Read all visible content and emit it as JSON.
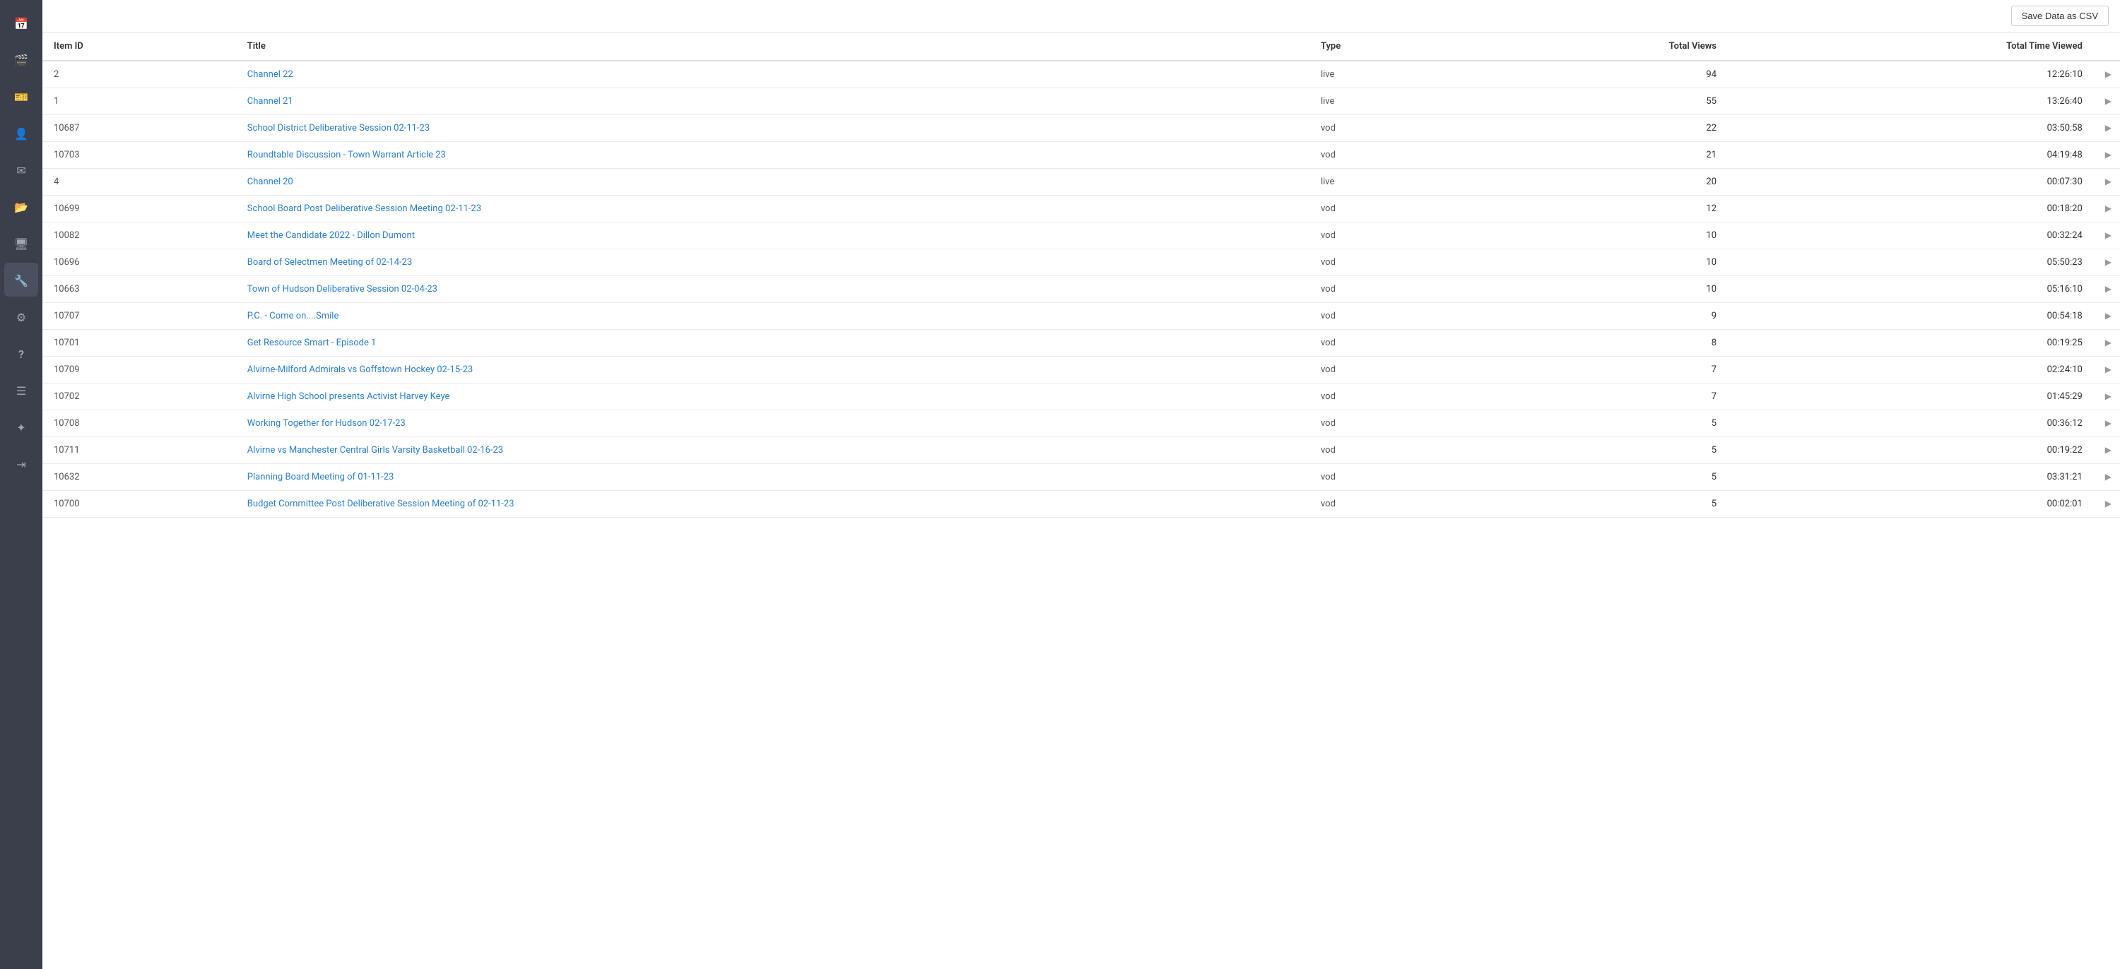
{
  "sidebar": {
    "items": [
      {
        "id": "calendar",
        "icon": "icon-calendar",
        "label": "Calendar",
        "active": false
      },
      {
        "id": "film",
        "icon": "icon-film",
        "label": "Media",
        "active": false
      },
      {
        "id": "badge",
        "icon": "icon-badge",
        "label": "Badge",
        "active": false
      },
      {
        "id": "user",
        "icon": "icon-user",
        "label": "User",
        "active": false
      },
      {
        "id": "send",
        "icon": "icon-send",
        "label": "Send",
        "active": false
      },
      {
        "id": "folder",
        "icon": "icon-folder",
        "label": "Folder",
        "active": false
      },
      {
        "id": "monitor",
        "icon": "icon-monitor",
        "label": "Monitor",
        "active": false
      },
      {
        "id": "wrench",
        "icon": "icon-wrench",
        "label": "Tools",
        "active": true
      },
      {
        "id": "gear",
        "icon": "icon-gear",
        "label": "Settings",
        "active": false
      },
      {
        "id": "question",
        "icon": "icon-question",
        "label": "Help",
        "active": false
      },
      {
        "id": "list",
        "icon": "icon-list",
        "label": "Reports",
        "active": false
      },
      {
        "id": "star",
        "icon": "icon-star",
        "label": "Favorites",
        "active": false
      },
      {
        "id": "logout",
        "icon": "icon-logout",
        "label": "Logout",
        "active": false
      }
    ]
  },
  "toolbar": {
    "save_csv_label": "Save Data as CSV"
  },
  "table": {
    "columns": [
      {
        "key": "item_id",
        "label": "Item ID"
      },
      {
        "key": "title",
        "label": "Title"
      },
      {
        "key": "type",
        "label": "Type"
      },
      {
        "key": "total_views",
        "label": "Total Views"
      },
      {
        "key": "total_time_viewed",
        "label": "Total Time Viewed"
      }
    ],
    "rows": [
      {
        "item_id": "2",
        "title": "Channel 22",
        "type": "live",
        "total_views": "94",
        "total_time_viewed": "12:26:10"
      },
      {
        "item_id": "1",
        "title": "Channel 21",
        "type": "live",
        "total_views": "55",
        "total_time_viewed": "13:26:40"
      },
      {
        "item_id": "10687",
        "title": "School District Deliberative Session 02-11-23",
        "type": "vod",
        "total_views": "22",
        "total_time_viewed": "03:50:58"
      },
      {
        "item_id": "10703",
        "title": "Roundtable Discussion - Town Warrant Article 23",
        "type": "vod",
        "total_views": "21",
        "total_time_viewed": "04:19:48"
      },
      {
        "item_id": "4",
        "title": "Channel 20",
        "type": "live",
        "total_views": "20",
        "total_time_viewed": "00:07:30"
      },
      {
        "item_id": "10699",
        "title": "School Board Post Deliberative Session Meeting 02-11-23",
        "type": "vod",
        "total_views": "12",
        "total_time_viewed": "00:18:20"
      },
      {
        "item_id": "10082",
        "title": "Meet the Candidate 2022 - Dillon Dumont",
        "type": "vod",
        "total_views": "10",
        "total_time_viewed": "00:32:24"
      },
      {
        "item_id": "10696",
        "title": "Board of Selectmen Meeting of 02-14-23",
        "type": "vod",
        "total_views": "10",
        "total_time_viewed": "05:50:23"
      },
      {
        "item_id": "10663",
        "title": "Town of Hudson Deliberative Session 02-04-23",
        "type": "vod",
        "total_views": "10",
        "total_time_viewed": "05:16:10"
      },
      {
        "item_id": "10707",
        "title": "P.C. - Come on....Smile",
        "type": "vod",
        "total_views": "9",
        "total_time_viewed": "00:54:18"
      },
      {
        "item_id": "10701",
        "title": "Get Resource Smart - Episode 1",
        "type": "vod",
        "total_views": "8",
        "total_time_viewed": "00:19:25"
      },
      {
        "item_id": "10709",
        "title": "Alvirne-Milford Admirals vs Goffstown Hockey 02-15-23",
        "type": "vod",
        "total_views": "7",
        "total_time_viewed": "02:24:10"
      },
      {
        "item_id": "10702",
        "title": "Alvirne High School presents Activist Harvey Keye",
        "type": "vod",
        "total_views": "7",
        "total_time_viewed": "01:45:29"
      },
      {
        "item_id": "10708",
        "title": "Working Together for Hudson 02-17-23",
        "type": "vod",
        "total_views": "5",
        "total_time_viewed": "00:36:12"
      },
      {
        "item_id": "10711",
        "title": "Alvirne vs Manchester Central Girls Varsity Basketball 02-16-23",
        "type": "vod",
        "total_views": "5",
        "total_time_viewed": "00:19:22"
      },
      {
        "item_id": "10632",
        "title": "Planning Board Meeting of 01-11-23",
        "type": "vod",
        "total_views": "5",
        "total_time_viewed": "03:31:21"
      },
      {
        "item_id": "10700",
        "title": "Budget Committee Post Deliberative Session Meeting of 02-11-23",
        "type": "vod",
        "total_views": "5",
        "total_time_viewed": "00:02:01"
      }
    ]
  }
}
